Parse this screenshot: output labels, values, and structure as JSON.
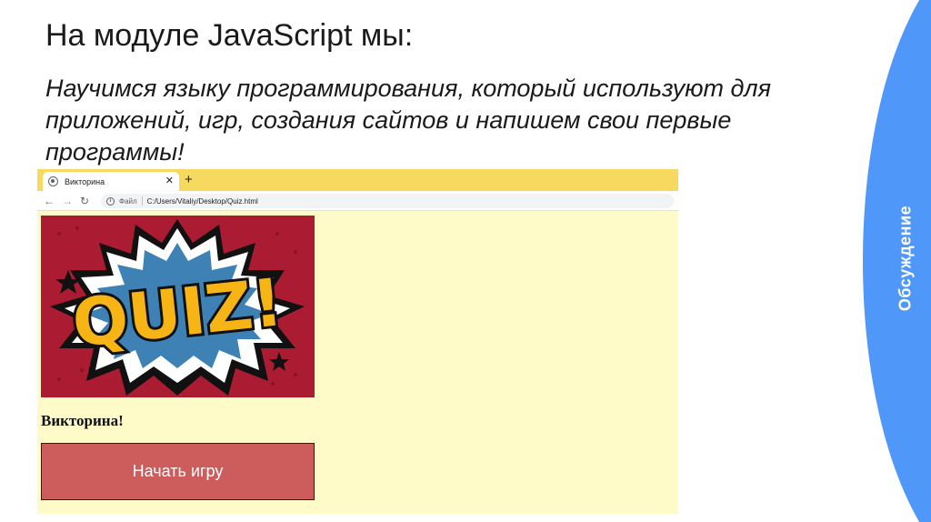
{
  "slide": {
    "title": "На модуле JavaScript мы:",
    "subtitle": "Научимся языку программирования, который используют для приложений, игр, создания сайтов и напишем свои первые программы!",
    "side_label": "Обсуждение",
    "colors": {
      "side_accent": "#4f97f9",
      "text": "#1a1a1a"
    }
  },
  "browser": {
    "tab": {
      "title": "Викторина",
      "favicon": "globe-icon",
      "close": "✕"
    },
    "new_tab": "+",
    "nav": {
      "back": "←",
      "forward": "→",
      "reload": "↻"
    },
    "address": {
      "info": "i",
      "scheme": "Файл",
      "url": "C:/Users/Vitaliy/Desktop/Quiz.html"
    },
    "colors": {
      "tabbar": "#f6d95e",
      "page_bg": "#fffbc8",
      "button": "#cd5c5c"
    }
  },
  "page": {
    "image_text": "QUIZ!",
    "heading": "Викторина!",
    "start_button": "Начать игру"
  }
}
